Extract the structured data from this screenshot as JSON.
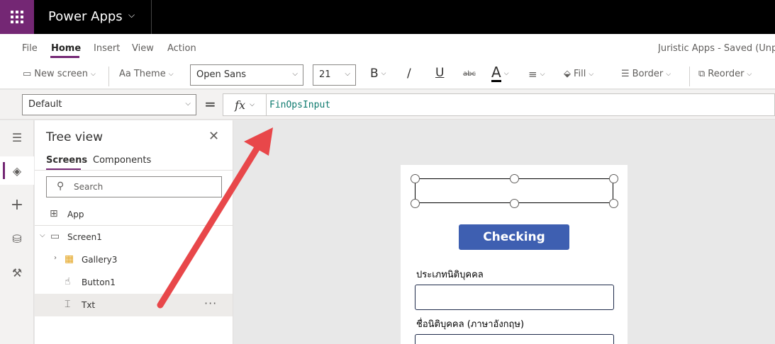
{
  "app": {
    "title": "Power Apps"
  },
  "menu": {
    "items": [
      "File",
      "Home",
      "Insert",
      "View",
      "Action"
    ],
    "active": "Home",
    "document_title": "Juristic Apps - Saved (Unpu"
  },
  "toolbar": {
    "new_screen": "New screen",
    "theme": "Theme",
    "font": "Open Sans",
    "font_size": "21",
    "bold": "B",
    "italic": "/",
    "underline": "U",
    "strike": "abc",
    "font_color": "A",
    "fill": "Fill",
    "border": "Border",
    "reorder": "Reorder",
    "font_color_hex": "#000000"
  },
  "formula": {
    "property": "Default",
    "equals": "=",
    "fx": "fx",
    "value": "FinOpsInput"
  },
  "tree": {
    "title": "Tree view",
    "tabs": [
      "Screens",
      "Components"
    ],
    "search_placeholder": "Search",
    "items": [
      {
        "label": "App",
        "icon": "app-icon"
      },
      {
        "label": "Screen1",
        "icon": "screen-icon"
      },
      {
        "label": "Gallery3",
        "icon": "gallery-icon"
      },
      {
        "label": "Button1",
        "icon": "button-icon"
      },
      {
        "label": "Txt",
        "icon": "text-input-icon"
      }
    ],
    "more": "···"
  },
  "canvas": {
    "button_label": "Checking",
    "label_1": "ประเภทนิติบุคคล",
    "label_2": "ชื่อนิติบุคคล (ภาษาอังกฤษ)",
    "button_color": "#3e5fb1",
    "arrow_color": "#e8474a"
  }
}
